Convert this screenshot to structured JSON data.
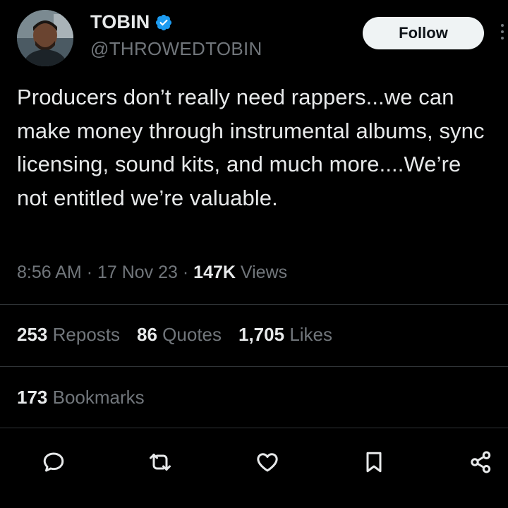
{
  "author": {
    "name": "TOBIN",
    "handle": "@THROWEDTOBIN",
    "verified_color": "#1d9bf0"
  },
  "follow_label": "Follow",
  "tweet": {
    "text": "Producers don’t really need rappers...we can make money through instrumental albums, sync licensing, sound kits, and much more....We’re not entitled we’re valuable."
  },
  "meta": {
    "time": "8:56 AM",
    "date": "17 Nov 23",
    "views_count": "147K",
    "views_label": "Views"
  },
  "stats": {
    "reposts_count": "253",
    "reposts_label": "Reposts",
    "quotes_count": "86",
    "quotes_label": "Quotes",
    "likes_count": "1,705",
    "likes_label": "Likes",
    "bookmarks_count": "173",
    "bookmarks_label": "Bookmarks"
  },
  "actions": [
    "reply-icon",
    "repost-icon",
    "like-icon",
    "bookmark-icon",
    "share-icon"
  ],
  "colors": {
    "background": "#000000",
    "text": "#e7e9ea",
    "muted": "#71767b",
    "divider": "#2f3336"
  }
}
